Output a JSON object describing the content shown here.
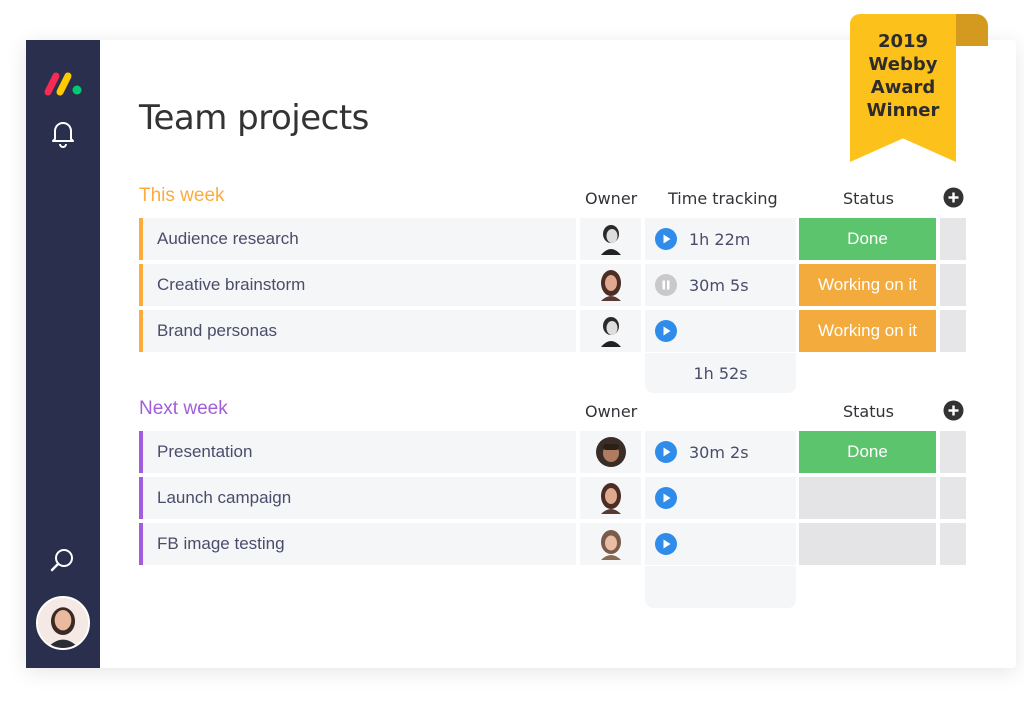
{
  "page_title": "Team projects",
  "award": {
    "line1": "2019",
    "line2": "Webby",
    "line3": "Award",
    "line4": "Winner"
  },
  "colors": {
    "sidebar": "#292f4c",
    "this_week": "#fdab3d",
    "next_week": "#a25ddc",
    "done": "#5cc46c",
    "working": "#f2ab3c",
    "play": "#2f8cea",
    "award": "#fcc11b"
  },
  "groups": [
    {
      "title": "This week",
      "color": "#fdab3d",
      "headers": {
        "owner": "Owner",
        "time": "Time tracking",
        "status": "Status"
      },
      "rows": [
        {
          "name": "Audience research",
          "owner_icon": "man-avatar",
          "timer_state": "play",
          "time": "1h 22m",
          "status": "Done"
        },
        {
          "name": "Creative brainstorm",
          "owner_icon": "woman-avatar",
          "timer_state": "pause",
          "time": "30m 5s",
          "status": "Working on it"
        },
        {
          "name": "Brand personas",
          "owner_icon": "man-avatar",
          "timer_state": "play",
          "time": "",
          "status": "Working on it"
        }
      ],
      "time_total": "1h 52s"
    },
    {
      "title": "Next week",
      "color": "#a25ddc",
      "headers": {
        "owner": "Owner",
        "status": "Status"
      },
      "rows": [
        {
          "name": "Presentation",
          "owner_icon": "man-avatar",
          "timer_state": "play",
          "time": "30m 2s",
          "status": "Done"
        },
        {
          "name": "Launch campaign",
          "owner_icon": "woman-avatar",
          "timer_state": "play",
          "time": "",
          "status": ""
        },
        {
          "name": "FB image testing",
          "owner_icon": "woman-avatar",
          "timer_state": "play",
          "time": "",
          "status": ""
        }
      ]
    }
  ]
}
